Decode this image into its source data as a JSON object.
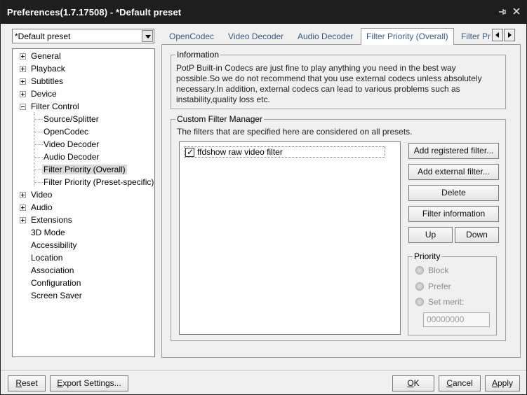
{
  "window": {
    "title": "Preferences(1.7.17508) - *Default preset"
  },
  "preset": {
    "selected": "*Default preset"
  },
  "tree": {
    "general": "General",
    "playback": "Playback",
    "subtitles": "Subtitles",
    "device": "Device",
    "filter_control": "Filter Control",
    "source_splitter": "Source/Splitter",
    "opencodec": "OpenCodec",
    "video_decoder": "Video Decoder",
    "audio_decoder": "Audio Decoder",
    "filter_priority_overall": "Filter Priority (Overall)",
    "filter_priority_preset": "Filter Priority (Preset-specific)",
    "video": "Video",
    "audio": "Audio",
    "extensions": "Extensions",
    "mode_3d": "3D Mode",
    "accessibility": "Accessibility",
    "location": "Location",
    "association": "Association",
    "configuration": "Configuration",
    "screen_saver": "Screen Saver"
  },
  "tabs": {
    "opencodec": "OpenCodec",
    "video_decoder": "Video Decoder",
    "audio_decoder": "Audio Decoder",
    "filter_priority_overall": "Filter Priority (Overall)",
    "filter_priority_preset_partial": "Filter Pr"
  },
  "information": {
    "title": "Information",
    "line1": "PotP Built-in Codecs are just fine to play anything you need in the best way",
    "line2": "possible.So we do not recommend that you use external codecs unless absolutely",
    "line3": "necessary.In addition, external codecs can lead to various problems such as",
    "line4": "instability,quality loss etc."
  },
  "custom_filter_manager": {
    "title": "Custom Filter Manager",
    "description": "The filters that are specified here are considered on all presets.",
    "filters": [
      {
        "name": "ffdshow raw video filter",
        "checked": true
      }
    ],
    "add_registered": "Add registered filter...",
    "add_external": "Add external filter...",
    "delete": "Delete",
    "filter_information": "Filter information",
    "up": "Up",
    "down": "Down"
  },
  "priority": {
    "title": "Priority",
    "block": "Block",
    "prefer": "Prefer",
    "set_merit": "Set merit:",
    "merit_value": "00000000"
  },
  "footer": {
    "reset_accel": "R",
    "reset_rest": "eset",
    "export_accel": "E",
    "export_rest": "xport Settings...",
    "ok_accel": "O",
    "ok_rest": "K",
    "cancel_accel": "C",
    "cancel_rest": "ancel",
    "apply_accel": "A",
    "apply_rest": "pply"
  },
  "colors": {
    "titlebar": "#1e1e1e",
    "tab_text": "#3a5a80",
    "window_bg": "#f0f0f0"
  }
}
